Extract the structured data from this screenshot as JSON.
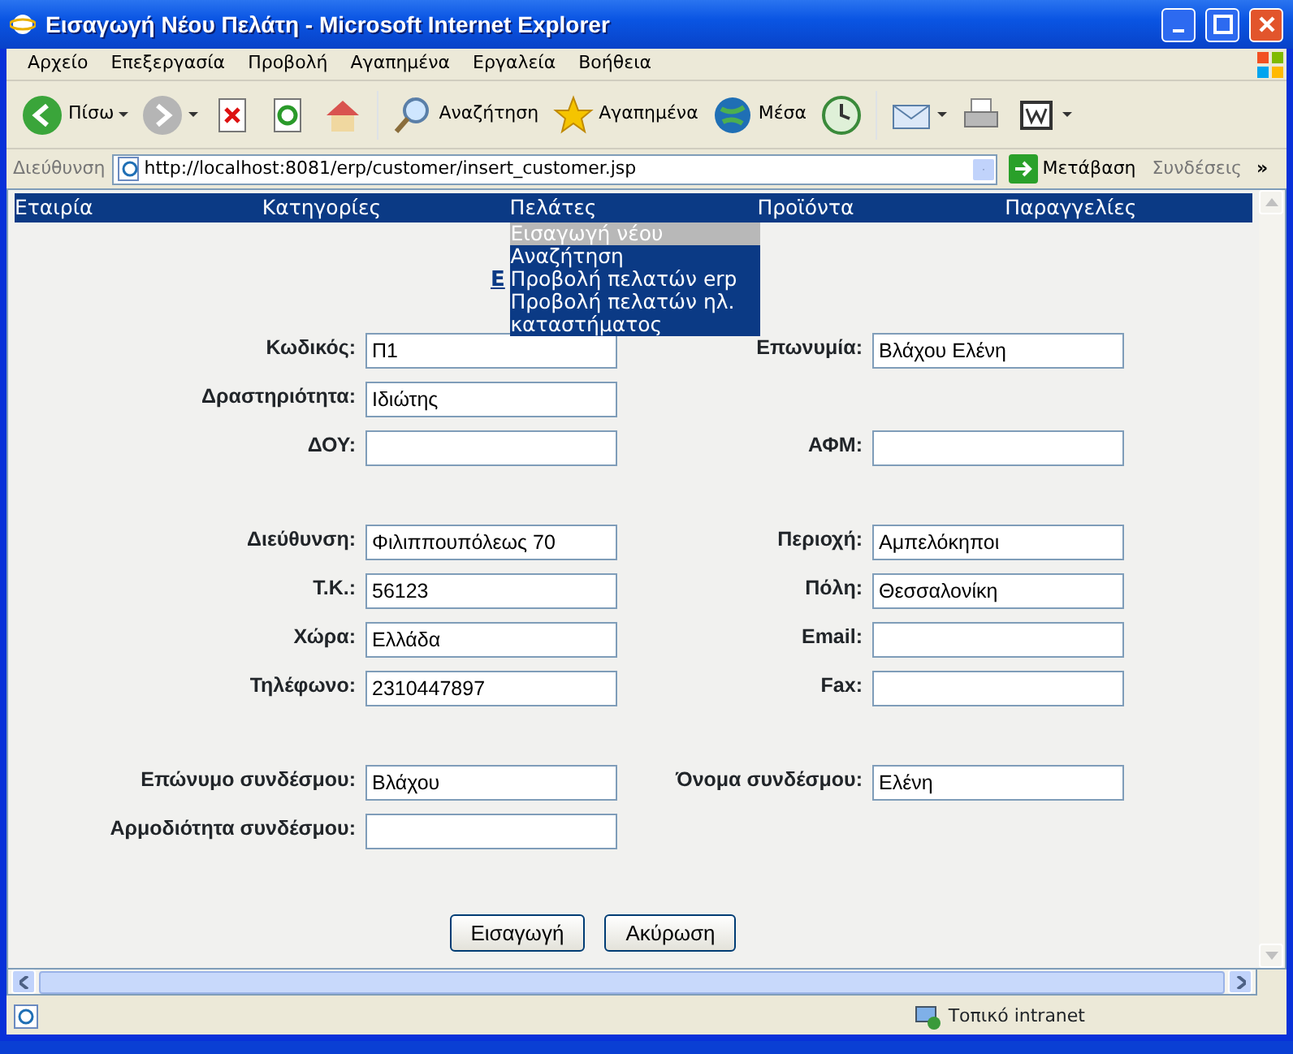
{
  "window": {
    "title": "Εισαγωγή Νέου Πελάτη - Microsoft Internet Explorer"
  },
  "menu_bar": [
    "Αρχείο",
    "Επεξεργασία",
    "Προβολή",
    "Αγαπημένα",
    "Εργαλεία",
    "Βοήθεια"
  ],
  "toolbar": [
    {
      "kind": "back",
      "label": "Πίσω"
    },
    {
      "kind": "forward"
    },
    {
      "kind": "stop"
    },
    {
      "kind": "refresh"
    },
    {
      "kind": "home"
    },
    {
      "kind": "search",
      "label": "Αναζήτηση"
    },
    {
      "kind": "favorites",
      "label": "Αγαπημένα"
    },
    {
      "kind": "media",
      "label": "Μέσα"
    },
    {
      "kind": "history"
    },
    {
      "kind": "mail"
    },
    {
      "kind": "print"
    },
    {
      "kind": "edit"
    }
  ],
  "address_bar": {
    "label": "Διεύθυνση",
    "url": "http://localhost:8081/erp/customer/insert_customer.jsp",
    "go": "Μετάβαση",
    "links": "Συνδέσεις",
    "more": "»"
  },
  "nav": {
    "items": [
      {
        "label": "Εταιρία"
      },
      {
        "label": "Κατηγορίες"
      },
      {
        "label": "Πελάτες",
        "dropdown": [
          {
            "label": "Εισαγωγή νέου",
            "selected": true
          },
          {
            "label": "Αναζήτηση",
            "selected": false
          },
          {
            "label": "Προβολή πελατών erp",
            "selected": false
          },
          {
            "label": "Προβολή πελατών ηλ. καταστήματος",
            "selected": false
          }
        ]
      },
      {
        "label": "Προϊόντα"
      },
      {
        "label": "Παραγγελίες"
      }
    ]
  },
  "heading": "Ε",
  "form": {
    "sections": [
      [
        {
          "left": {
            "label": "Κωδικός:",
            "value": "Π1"
          },
          "right": {
            "label": "Επωνυμία:",
            "value": "Βλάχου Ελένη"
          }
        },
        {
          "left": {
            "label": "Δραστηριότητα:",
            "value": "Ιδιώτης"
          }
        },
        {
          "left": {
            "label": "ΔΟΥ:"
          },
          "right": {
            "label": "ΑΦΜ:"
          }
        }
      ],
      [
        {
          "left": {
            "label": "Διεύθυνση:",
            "value": "Φιλιππουπόλεως 70"
          },
          "right": {
            "label": "Περιοχή:",
            "value": "Αμπελόκηποι"
          }
        },
        {
          "left": {
            "label": "Τ.Κ.:",
            "value": "56123"
          },
          "right": {
            "label": "Πόλη:",
            "value": "Θεσσαλονίκη"
          }
        },
        {
          "left": {
            "label": "Χώρα:",
            "value": "Ελλάδα"
          },
          "right": {
            "label": "Email:"
          }
        },
        {
          "left": {
            "label": "Τηλέφωνο:",
            "value": "2310447897"
          },
          "right": {
            "label": "Fax:"
          }
        }
      ],
      [
        {
          "left": {
            "label": "Επώνυμο συνδέσμου:",
            "value": "Βλάχου"
          },
          "right": {
            "label": "Όνομα συνδέσμου:",
            "value": "Ελένη"
          }
        },
        {
          "left": {
            "label": "Αρμοδιότητα συνδέσμου:"
          }
        }
      ]
    ],
    "buttons": [
      "Εισαγωγή",
      "Ακύρωση"
    ]
  },
  "status_bar": {
    "zone": "Τοπικό intranet"
  }
}
